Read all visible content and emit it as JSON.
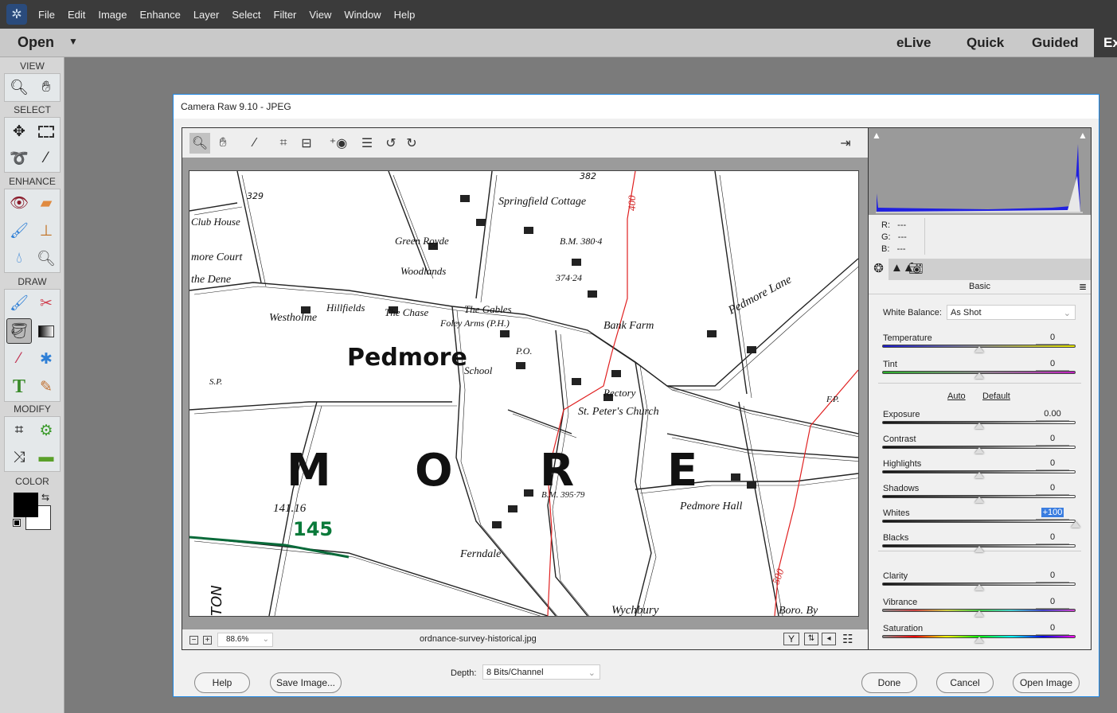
{
  "menubar": {
    "items": [
      "File",
      "Edit",
      "Image",
      "Enhance",
      "Layer",
      "Select",
      "Filter",
      "View",
      "Window",
      "Help"
    ]
  },
  "modebar": {
    "open_label": "Open",
    "modes": [
      "eLive",
      "Quick",
      "Guided",
      "Ex"
    ]
  },
  "toolbox": {
    "sections": [
      "VIEW",
      "SELECT",
      "ENHANCE",
      "DRAW",
      "MODIFY",
      "COLOR"
    ],
    "tools": {
      "view": [
        "zoom",
        "hand"
      ],
      "select": [
        "move",
        "marquee",
        "lasso",
        "quick-selection"
      ],
      "enhance": [
        "red-eye",
        "spot-healing",
        "smart-brush",
        "clone-stamp",
        "blur",
        "sponge"
      ],
      "draw": [
        "brush",
        "eraser",
        "paint-bucket",
        "gradient",
        "eyedropper",
        "custom-shape",
        "type",
        "pencil"
      ],
      "modify": [
        "crop",
        "recompose",
        "content-aware-move",
        "straighten"
      ]
    },
    "foreground_color": "#000000",
    "background_color": "#ffffff"
  },
  "dialog": {
    "title": "Camera Raw 9.10  -  JPEG",
    "toolbar_icons": [
      "zoom-icon",
      "hand-icon",
      "white-balance-icon",
      "crop-icon",
      "straighten-icon",
      "red-eye-icon",
      "preferences-icon",
      "rotate-ccw-icon",
      "rotate-cw-icon"
    ],
    "zoom_level": "88.6%",
    "filename": "ordnance-survey-historical.jpg",
    "map_labels": [
      "Club House",
      "more Court",
      "the Dene",
      "Westholme",
      "Hillfields",
      "The Chase",
      "Green Royde",
      "Woodlands",
      "Springfield Cottage",
      "The Gables",
      "Foley Arms (P.H.)",
      "Bank Farm",
      "Pedmore",
      "School",
      "P.O.",
      "Rectory",
      "St. Peter's Church",
      "Pedmore Lane",
      "M",
      "O",
      "R",
      "E",
      "Pedmore Hall",
      "Ferndale",
      "Wychbury",
      "Boro. By",
      "B.M. 395·79",
      "B.M. 380·4",
      "374·24",
      "400",
      "500",
      "329",
      "382",
      "S.P.",
      "F.P.",
      "145",
      "141.16",
      "TON"
    ],
    "histogram": {
      "r": "---",
      "g": "---",
      "b": "---"
    },
    "panel_title": "Basic",
    "white_balance": {
      "label": "White Balance:",
      "value": "As Shot"
    },
    "auto_label": "Auto",
    "default_label": "Default",
    "sliders": [
      {
        "label": "Temperature",
        "value": "0",
        "position": 0.5
      },
      {
        "label": "Tint",
        "value": "0",
        "position": 0.5
      },
      {
        "label": "Exposure",
        "value": "0.00",
        "position": 0.5
      },
      {
        "label": "Contrast",
        "value": "0",
        "position": 0.5
      },
      {
        "label": "Highlights",
        "value": "0",
        "position": 0.5
      },
      {
        "label": "Shadows",
        "value": "0",
        "position": 0.5
      },
      {
        "label": "Whites",
        "value": "+100",
        "position": 1.0
      },
      {
        "label": "Blacks",
        "value": "0",
        "position": 0.5
      },
      {
        "label": "Clarity",
        "value": "0",
        "position": 0.5
      },
      {
        "label": "Vibrance",
        "value": "0",
        "position": 0.5
      },
      {
        "label": "Saturation",
        "value": "0",
        "position": 0.5
      }
    ],
    "buttons": {
      "help": "Help",
      "save": "Save Image...",
      "done": "Done",
      "cancel": "Cancel",
      "open": "Open Image"
    },
    "depth": {
      "label": "Depth:",
      "value": "8 Bits/Channel"
    },
    "accent": "#1e88e5"
  }
}
